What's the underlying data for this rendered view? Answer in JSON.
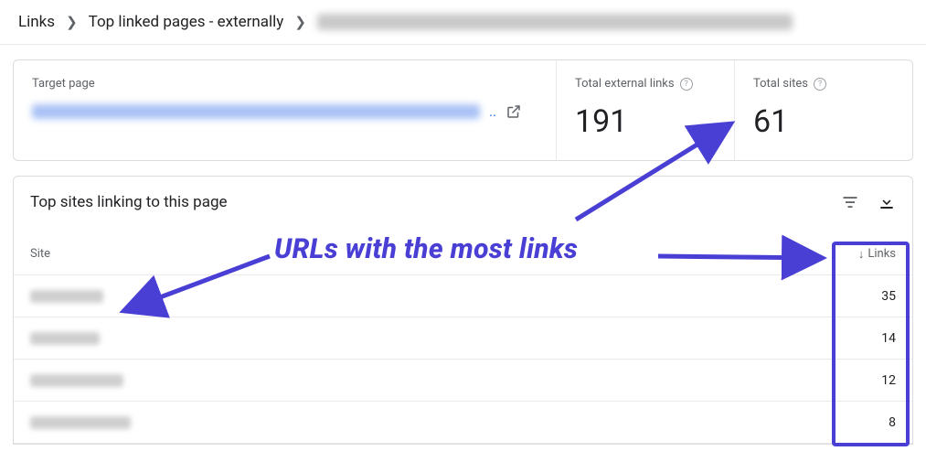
{
  "breadcrumb": {
    "links": "Links",
    "top_linked": "Top linked pages - externally"
  },
  "cards": {
    "target_label": "Target page",
    "target_dots": "..",
    "ext_label": "Total external links",
    "ext_value": "191",
    "sites_label": "Total sites",
    "sites_value": "61"
  },
  "panel": {
    "title": "Top sites linking to this page"
  },
  "table": {
    "site_header": "Site",
    "links_header": "Links",
    "rows": [
      {
        "links": "35"
      },
      {
        "links": "14"
      },
      {
        "links": "12"
      },
      {
        "links": "8"
      }
    ]
  },
  "annotation": {
    "label": "URLs with the most links"
  }
}
